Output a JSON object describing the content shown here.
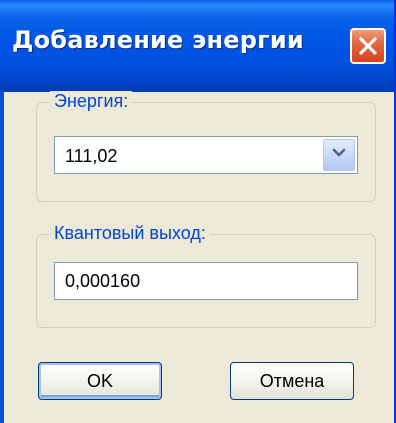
{
  "window": {
    "title": "Добавление энергии"
  },
  "energy": {
    "legend": "Энергия:",
    "selected_value": "111,02"
  },
  "quantum": {
    "legend": "Квантовый выход:",
    "value": "0,000160"
  },
  "buttons": {
    "ok_label": "OK",
    "cancel_label": "Отмена"
  },
  "icons": {
    "close": "close-icon",
    "dropdown": "chevron-down-icon"
  },
  "colors": {
    "titlebar": "#0055e5",
    "close_button": "#e26a44",
    "legend_text": "#0046d5",
    "dialog_background": "#ece9d8"
  }
}
